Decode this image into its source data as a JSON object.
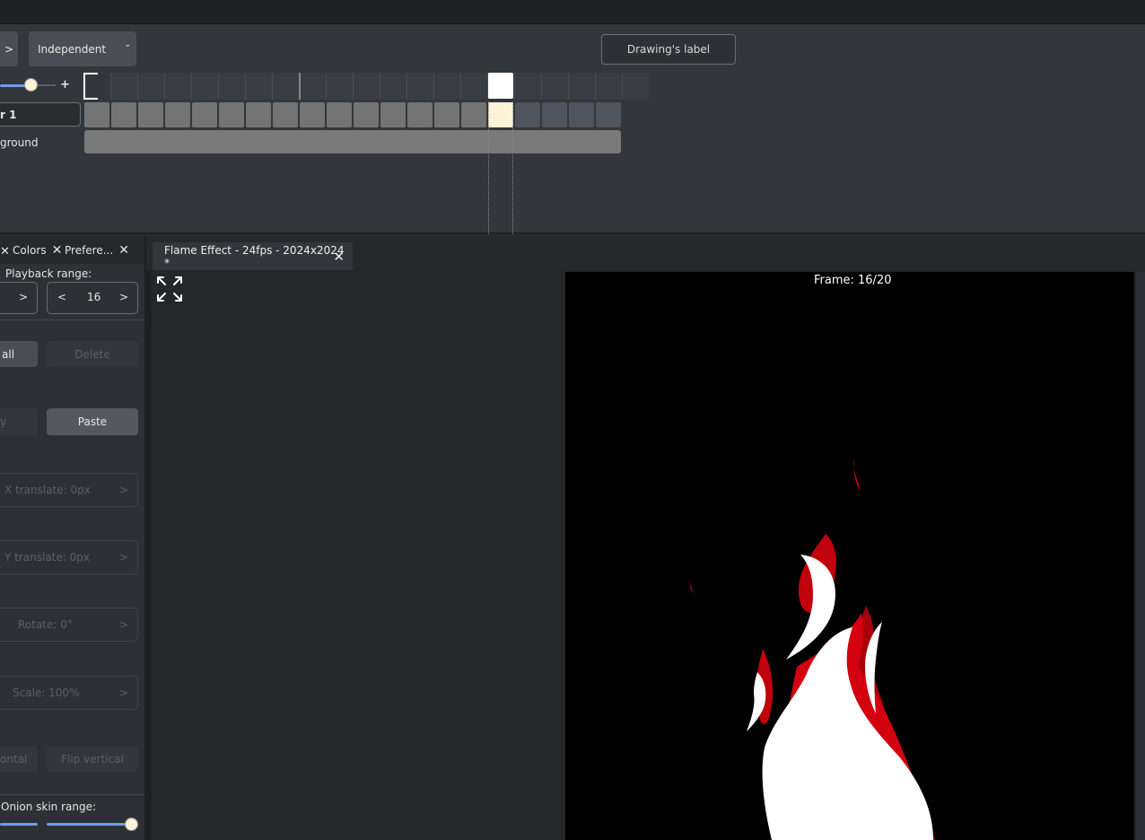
{
  "toolbar": {
    "next_label": ">",
    "mode_select": "Independent",
    "drawing_label_button": "Drawing's label",
    "zoom_plus": "+"
  },
  "layers": [
    {
      "name": "r 1"
    },
    {
      "name": "ground"
    }
  ],
  "panel": {
    "tabs": [
      {
        "label": "Colors"
      },
      {
        "label": "Prefere..."
      }
    ],
    "playback_range_label": "Playback range:",
    "range_start_next": ">",
    "range_end_prev": "<",
    "range_end_value": "16",
    "range_end_next": ">",
    "select_all_label": "all",
    "delete_label": "Delete",
    "copy_label": "y",
    "paste_label": "Paste",
    "x_translate": "X translate: 0px",
    "y_translate": "Y translate: 0px",
    "rotate": "Rotate: 0°",
    "scale": "Scale: 100%",
    "field_arrow": ">",
    "flip_horizontal": "ontal",
    "flip_vertical": "Flip vertical",
    "onion_skin_label": "Onion skin range:"
  },
  "document": {
    "tab_title": "Flame Effect - 24fps - 2024x2024 *",
    "frame_indicator": "Frame: 16/20"
  },
  "colors": {
    "accent_blue": "#6d9eeb",
    "current_frame": "#fdf3d6",
    "flame_red": "#c0000b",
    "flame_white": "#ffffff"
  }
}
